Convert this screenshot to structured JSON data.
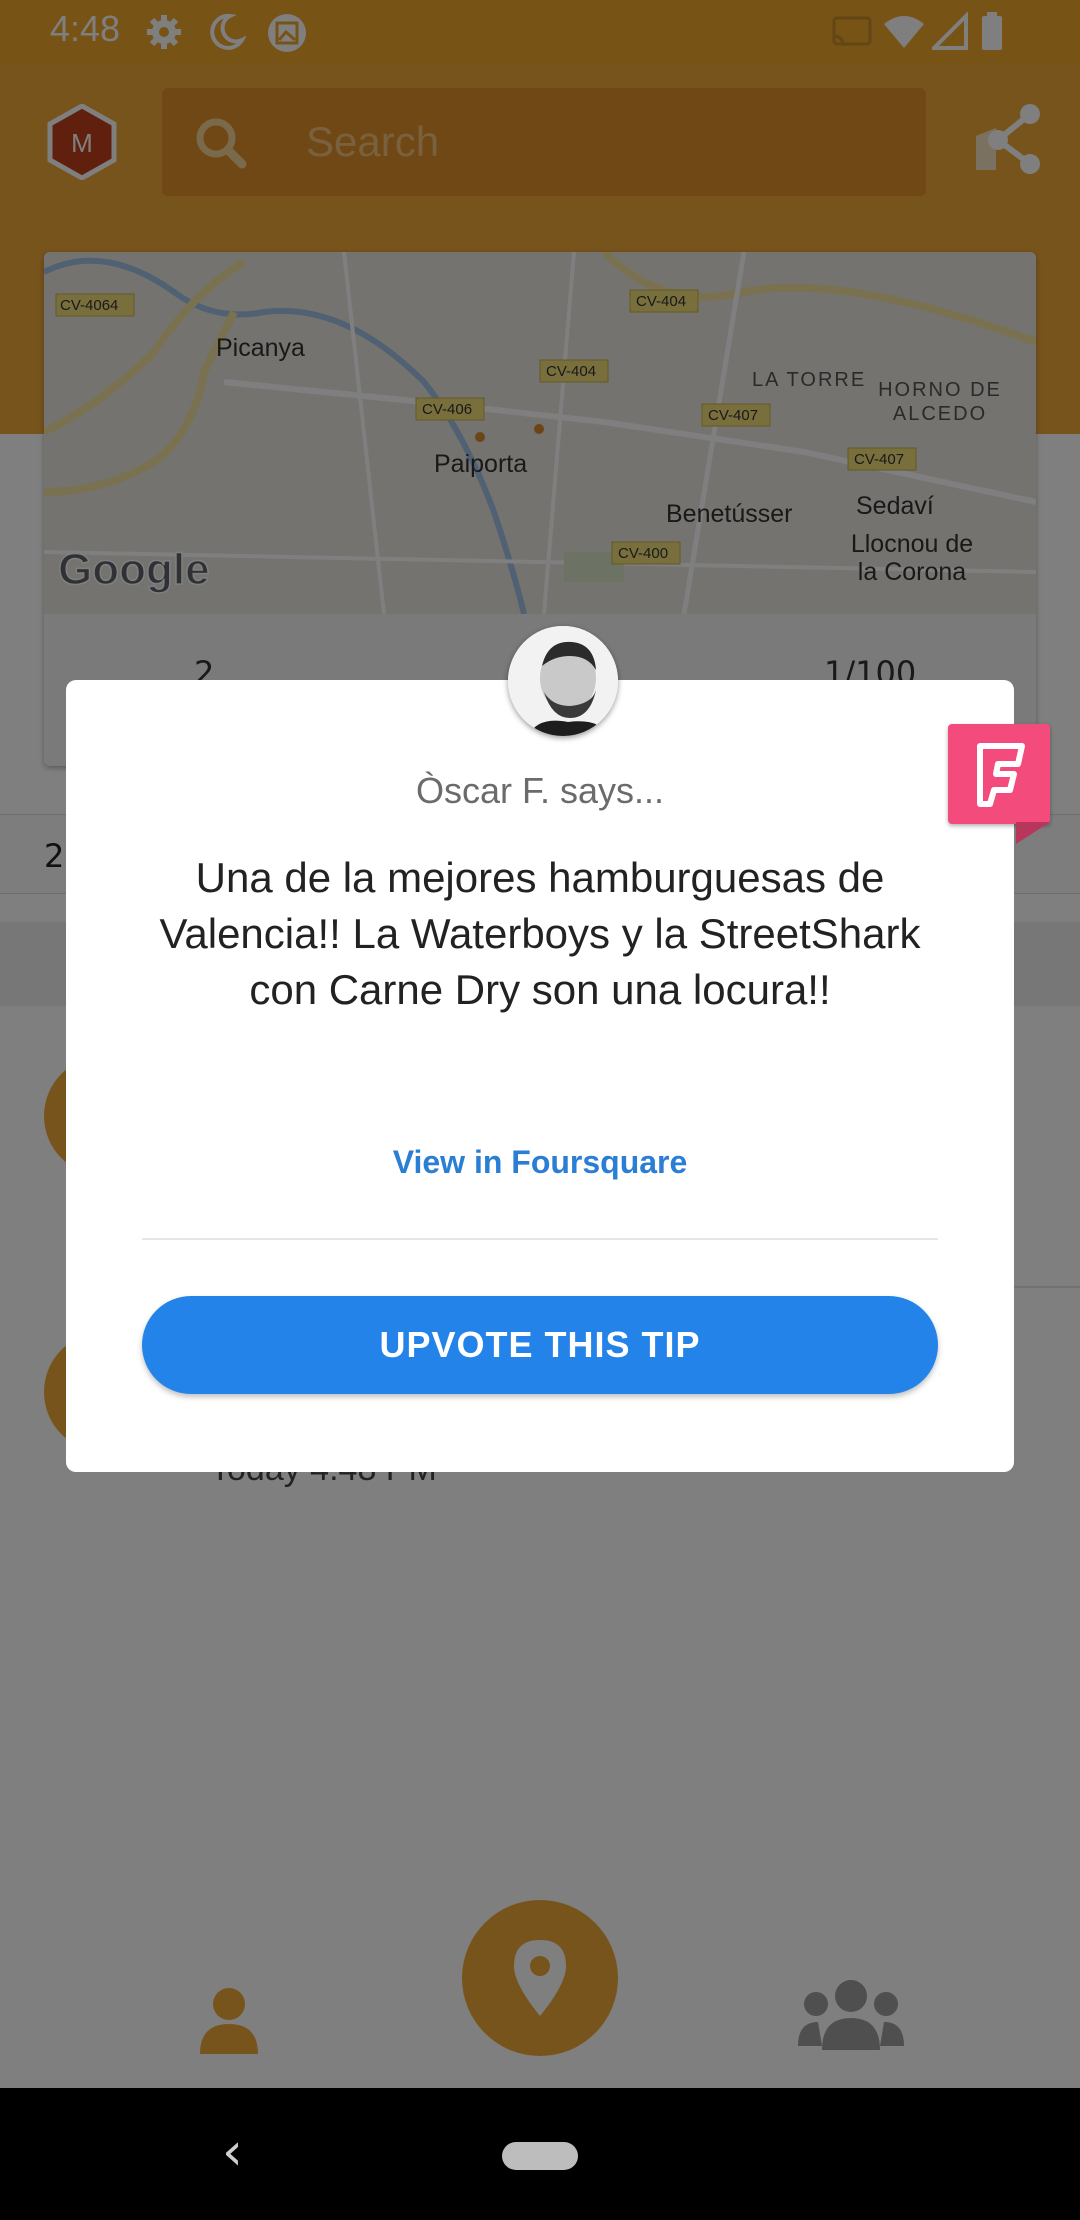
{
  "status_bar": {
    "time": "4:48",
    "icons": [
      "gear-icon",
      "moon-icon",
      "image-icon",
      "cast-icon",
      "wifi-icon",
      "signal-icon",
      "battery-icon"
    ]
  },
  "header": {
    "avatar_initial": "M",
    "search_placeholder": "Search"
  },
  "map": {
    "labels": {
      "picanya": "Picanya",
      "paiporta": "Paiporta",
      "benetusser": "Benetússer",
      "la_torre": "LA TORRE",
      "horno1": "HORNO DE",
      "horno2": "ALCEDO",
      "sedavi": "Sedaví",
      "llocnou1": "Llocnou de",
      "llocnou2": "la Corona"
    },
    "roads": {
      "cv4064": "CV-4064",
      "cv404a": "CV-404",
      "cv404b": "CV-404",
      "cv406": "CV-406",
      "cv407a": "CV-407",
      "cv407b": "CV-407",
      "cv400": "CV-400"
    },
    "attribution": "Google"
  },
  "stats": {
    "left": "2",
    "right": "1/100"
  },
  "list": {
    "count_fragment": "2",
    "timestamp": "Today 4:48 PM"
  },
  "dialog": {
    "says": "Òscar F. says...",
    "tip": "Una de la mejores hamburguesas de Valencia!! La Waterboys y la StreetShark con Carne Dry son una locura!!",
    "view_link": "View in Foursquare",
    "upvote_label": "UPVOTE THIS TIP"
  },
  "colors": {
    "brand_orange": "#f0a83a",
    "upvote_blue": "#2383e8",
    "link_blue": "#2a7ed3",
    "foursquare_pink": "#f24b7c"
  }
}
